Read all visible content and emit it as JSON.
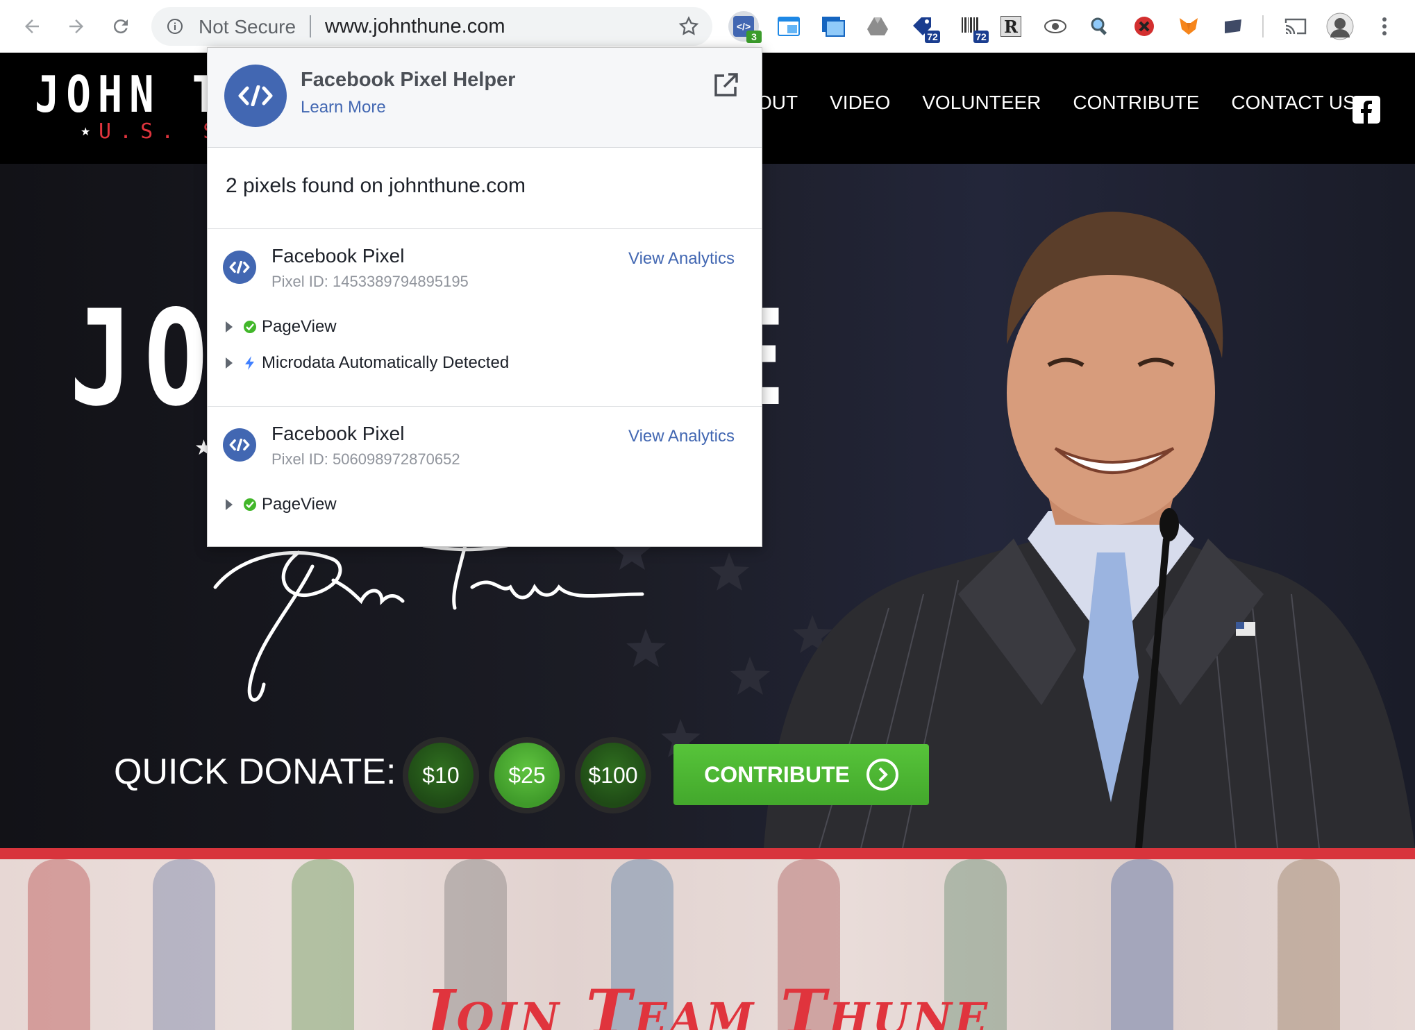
{
  "browser": {
    "security_label": "Not Secure",
    "url": "www.johnthune.com",
    "extensions": [
      {
        "name": "facebook-pixel-helper",
        "badge": "3",
        "badge_color": "#3b9c2b"
      },
      {
        "name": "window-icon"
      },
      {
        "name": "screenshot-icon"
      },
      {
        "name": "google-drive-icon"
      },
      {
        "name": "tag-icon",
        "badge": "72",
        "badge_color": "#1a3d8f"
      },
      {
        "name": "barcode-icon",
        "badge": "72",
        "badge_color": "#1a3d8f"
      },
      {
        "name": "r-icon"
      },
      {
        "name": "eye-icon"
      },
      {
        "name": "magnifier-icon"
      },
      {
        "name": "blocked-icon"
      },
      {
        "name": "fox-icon"
      },
      {
        "name": "flag-icon"
      },
      {
        "name": "cast-icon"
      },
      {
        "name": "profile-avatar"
      },
      {
        "name": "menu-icon"
      }
    ]
  },
  "site": {
    "logo_name": "JOHN TH",
    "logo_sub": "U.S. SEN",
    "nav": [
      "OUT",
      "VIDEO",
      "VOLUNTEER",
      "CONTRIBUTE",
      "CONTACT US"
    ],
    "hero_title": "JO",
    "hero_title_tail": "E",
    "quick_donate_label": "QUICK DONATE:",
    "donate_amounts": [
      "$10",
      "$25",
      "$100"
    ],
    "selected_amount": "$25",
    "contribute_label": "CONTRIBUTE",
    "team_title": "Join Team Thune",
    "colors": {
      "accent_red": "#d8343c",
      "donate_green": "#43a82c",
      "fb_blue": "#4267b2"
    }
  },
  "popup": {
    "title": "Facebook Pixel Helper",
    "learn_more": "Learn More",
    "summary": "2 pixels found on johnthune.com",
    "pixels": [
      {
        "name": "Facebook Pixel",
        "id_text": "Pixel ID: 1453389794895195",
        "analytics_label": "View Analytics",
        "events": [
          {
            "label": "PageView",
            "status": "success"
          },
          {
            "label": "Microdata Automatically Detected",
            "status": "info"
          }
        ]
      },
      {
        "name": "Facebook Pixel",
        "id_text": "Pixel ID: 506098972870652",
        "analytics_label": "View Analytics",
        "events": [
          {
            "label": "PageView",
            "status": "success"
          }
        ]
      }
    ]
  }
}
